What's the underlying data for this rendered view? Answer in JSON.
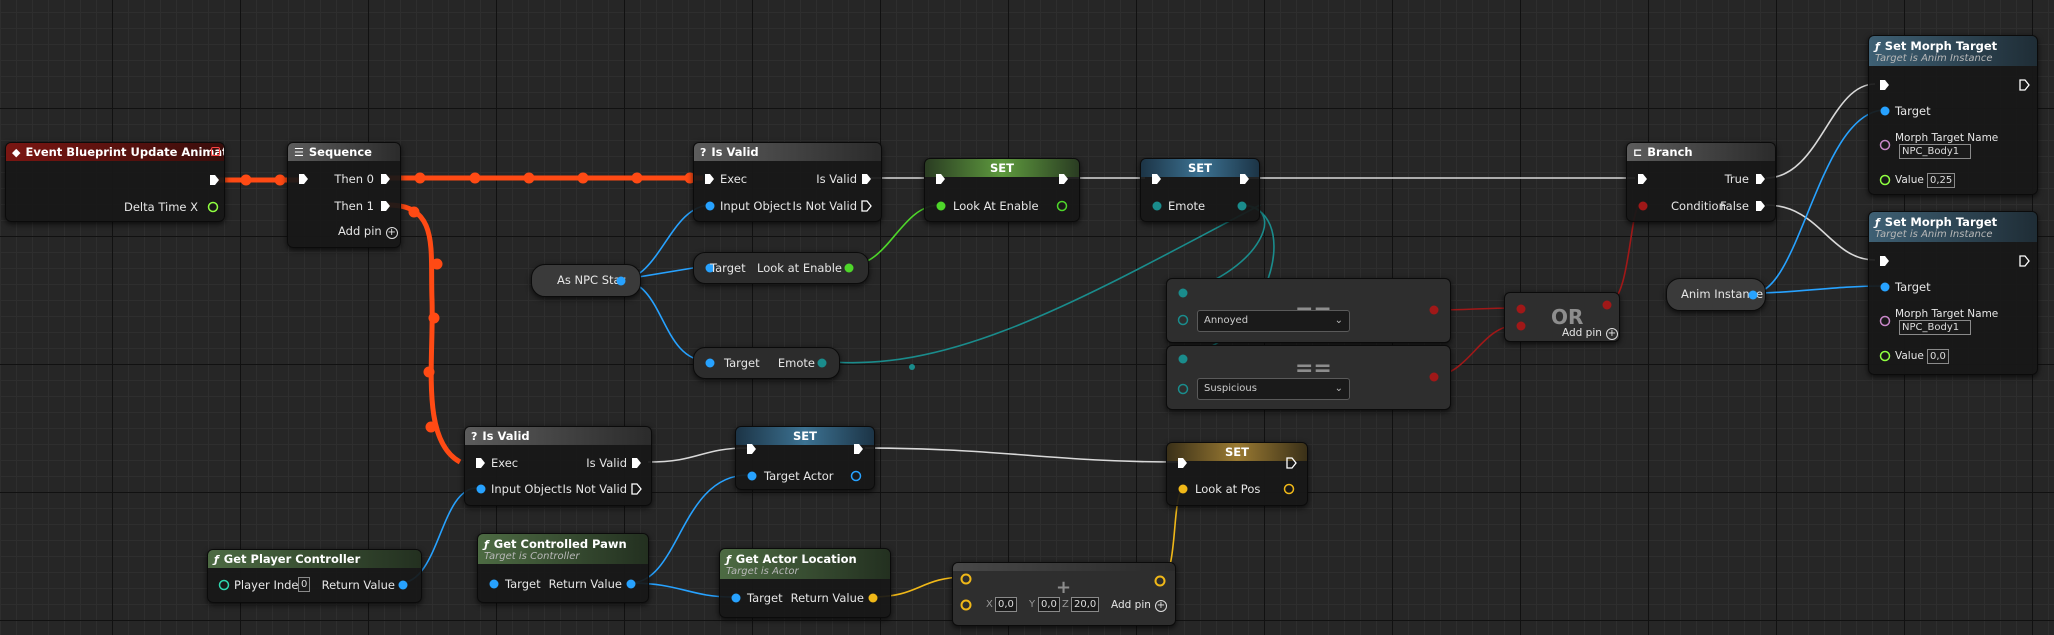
{
  "colors": {
    "exec": "#ffffff",
    "exec_active": "#ff4a14",
    "object": "#27a2ff",
    "boolean": "#4ed62a",
    "enum": "#1a8c8c",
    "vector": "#f0b818",
    "bool_red": "#a01818",
    "name": "#c887c8"
  },
  "nodes": {
    "event": {
      "title": "Event Blueprint Update Animation",
      "out_delta": "Delta Time X"
    },
    "sequence": {
      "title": "Sequence",
      "then0": "Then 0",
      "then1": "Then 1",
      "add_pin": "Add pin"
    },
    "isvalid1": {
      "title": "Is Valid",
      "exec": "Exec",
      "input": "Input Object",
      "is_valid": "Is Valid",
      "is_not_valid": "Is Not Valid"
    },
    "set_look_enable": {
      "title": "SET",
      "pin": "Look At Enable"
    },
    "set_emote": {
      "title": "SET",
      "pin": "Emote"
    },
    "as_npc": {
      "label": "As NPC Star"
    },
    "get_look_enable": {
      "target": "Target",
      "out": "Look at Enable"
    },
    "get_emote": {
      "target": "Target",
      "out": "Emote"
    },
    "eq1": {
      "value": "Annoyed"
    },
    "eq2": {
      "value": "Suspicious"
    },
    "or_node": {
      "title": "OR",
      "add_pin": "Add pin"
    },
    "branch": {
      "title": "Branch",
      "cond": "Condition",
      "true": "True",
      "false": "False"
    },
    "anim_instance": {
      "label": "Anim Instance"
    },
    "morph1": {
      "title": "Set Morph Target",
      "subtitle": "Target is Anim Instance",
      "target": "Target",
      "name_label": "Morph Target Name",
      "name_value": "NPC_Body1",
      "value_label": "Value",
      "value": "0,25"
    },
    "morph2": {
      "title": "Set Morph Target",
      "subtitle": "Target is Anim Instance",
      "target": "Target",
      "name_label": "Morph Target Name",
      "name_value": "NPC_Body1",
      "value_label": "Value",
      "value": "0,0"
    },
    "isvalid2": {
      "title": "Is Valid",
      "exec": "Exec",
      "input": "Input Object",
      "is_valid": "Is Valid",
      "is_not_valid": "Is Not Valid"
    },
    "set_target_actor": {
      "title": "SET",
      "pin": "Target Actor"
    },
    "set_look_pos": {
      "title": "SET",
      "pin": "Look at Pos"
    },
    "get_pc": {
      "title": "Get Player Controller",
      "player_index": "Player Index",
      "player_index_value": "0",
      "ret": "Return Value"
    },
    "get_pawn": {
      "title": "Get Controlled Pawn",
      "subtitle": "Target is Controller",
      "target": "Target",
      "ret": "Return Value"
    },
    "get_loc": {
      "title": "Get Actor Location",
      "subtitle": "Target is Actor",
      "target": "Target",
      "ret": "Return Value"
    },
    "add_vec": {
      "x_label": "X",
      "x": "0,0",
      "y_label": "Y",
      "y": "0,0",
      "z_label": "Z",
      "z": "20,0",
      "add_pin": "Add pin"
    }
  }
}
